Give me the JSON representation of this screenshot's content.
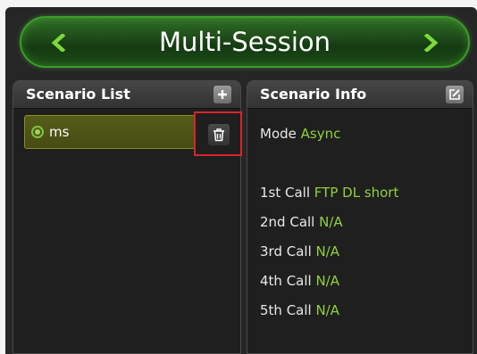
{
  "header": {
    "title": "Multi-Session",
    "prev_icon": "chevron-left-icon",
    "next_icon": "chevron-right-icon",
    "accent_color": "#7cd93a"
  },
  "scenario_list": {
    "title": "Scenario List",
    "add_icon": "plus-icon",
    "items": [
      {
        "label": "ms",
        "selected": true
      }
    ],
    "delete_icon": "trash-icon"
  },
  "scenario_info": {
    "title": "Scenario Info",
    "edit_icon": "edit-icon",
    "mode": {
      "label": "Mode",
      "value": "Async"
    },
    "calls": [
      {
        "label": "1st Call",
        "value": "FTP DL short"
      },
      {
        "label": "2nd Call",
        "value": "N/A"
      },
      {
        "label": "3rd Call",
        "value": "N/A"
      },
      {
        "label": "4th Call",
        "value": "N/A"
      },
      {
        "label": "5th Call",
        "value": "N/A"
      }
    ],
    "value_color": "#8fd13f"
  }
}
